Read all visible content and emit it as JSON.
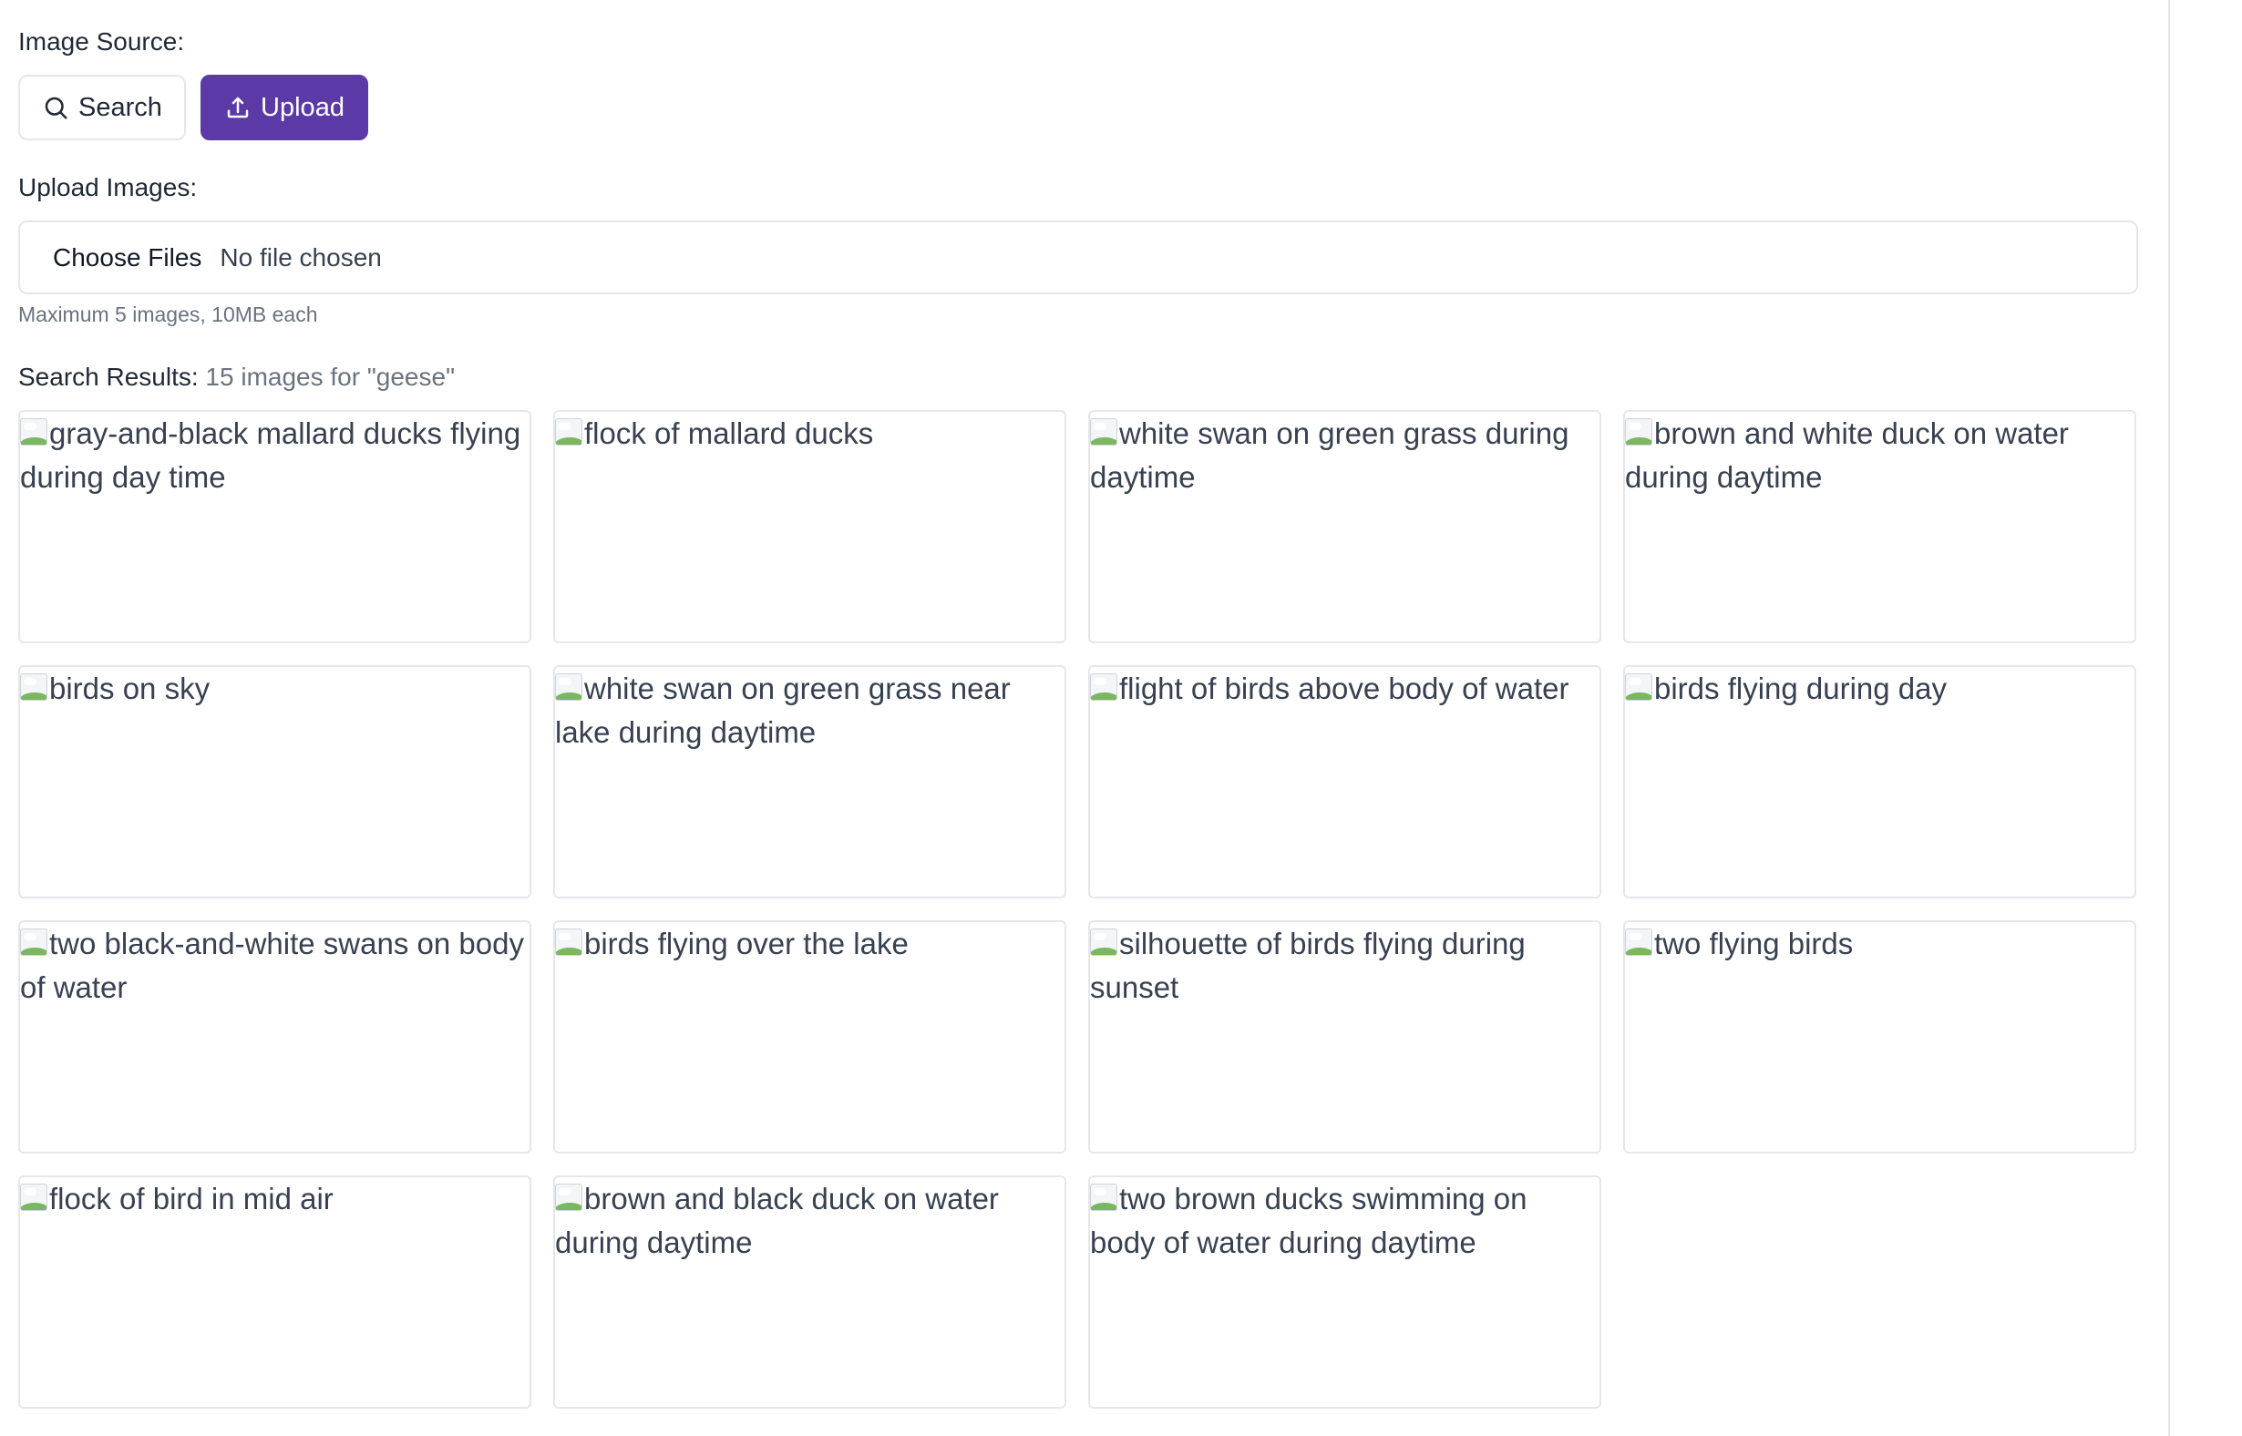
{
  "image_source": {
    "label": "Image Source:",
    "search_button": "Search",
    "upload_button": "Upload"
  },
  "upload": {
    "label": "Upload Images:",
    "choose_button": "Choose Files",
    "file_status": "No file chosen",
    "hint": "Maximum 5 images, 10MB each"
  },
  "results": {
    "label": "Search Results:",
    "count_text": "15 images for \"geese\"",
    "images": [
      {
        "alt": "gray-and-black mallard ducks flying during day time"
      },
      {
        "alt": "flock of mallard ducks"
      },
      {
        "alt": "white swan on green grass during daytime"
      },
      {
        "alt": "brown and white duck on water during daytime"
      },
      {
        "alt": "birds on sky"
      },
      {
        "alt": "white swan on green grass near lake during daytime"
      },
      {
        "alt": "flight of birds above body of water"
      },
      {
        "alt": "birds flying during day"
      },
      {
        "alt": "two black-and-white swans on body of water"
      },
      {
        "alt": "birds flying over the lake"
      },
      {
        "alt": "silhouette of birds flying during sunset"
      },
      {
        "alt": "two flying birds"
      },
      {
        "alt": "flock of bird in mid air"
      },
      {
        "alt": "brown and black duck on water during daytime"
      },
      {
        "alt": "two brown ducks swimming on body of water during daytime"
      }
    ]
  },
  "colors": {
    "accent": "#5b3aa8",
    "border": "#e5e7eb",
    "muted_text": "#6b7280"
  }
}
